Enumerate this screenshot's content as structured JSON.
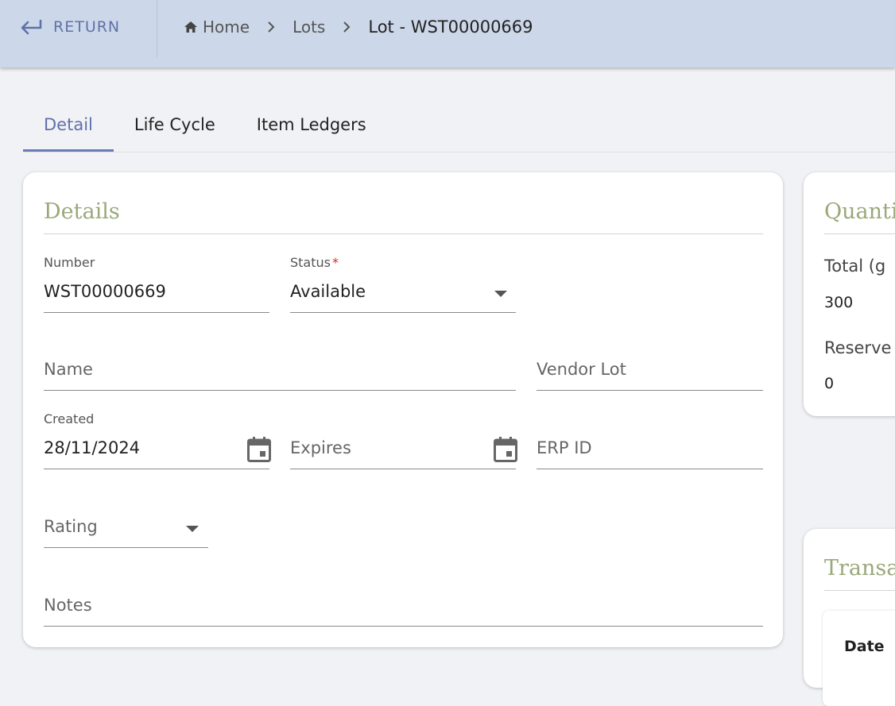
{
  "header": {
    "return_label": "RETURN",
    "breadcrumb": [
      {
        "label": "Home",
        "icon": "home-icon"
      },
      {
        "label": "Lots"
      },
      {
        "label": "Lot - WST00000669"
      }
    ]
  },
  "tabs": [
    {
      "label": "Detail",
      "active": true
    },
    {
      "label": "Life Cycle",
      "active": false
    },
    {
      "label": "Item Ledgers",
      "active": false
    }
  ],
  "details": {
    "title": "Details",
    "number": {
      "label": "Number",
      "value": "WST00000669"
    },
    "status": {
      "label": "Status",
      "required_mark": "*",
      "value": "Available"
    },
    "name": {
      "placeholder": "Name"
    },
    "vendor_lot": {
      "placeholder": "Vendor Lot"
    },
    "created": {
      "label": "Created",
      "value": "28/11/2024"
    },
    "expires": {
      "placeholder": "Expires"
    },
    "erp_id": {
      "placeholder": "ERP ID"
    },
    "rating": {
      "placeholder": "Rating"
    },
    "notes": {
      "placeholder": "Notes"
    }
  },
  "quantities": {
    "title": "Quantit",
    "total_label": "Total (g",
    "total_value": "300",
    "reserved_label": "Reserve",
    "reserved_value": "0"
  },
  "transactions": {
    "title": "Transac",
    "col_date": "Date"
  },
  "colors": {
    "accent": "#6071a9",
    "header_bg": "#ccd8e9",
    "section_title": "#9aa87a",
    "required": "#d32f2f"
  }
}
